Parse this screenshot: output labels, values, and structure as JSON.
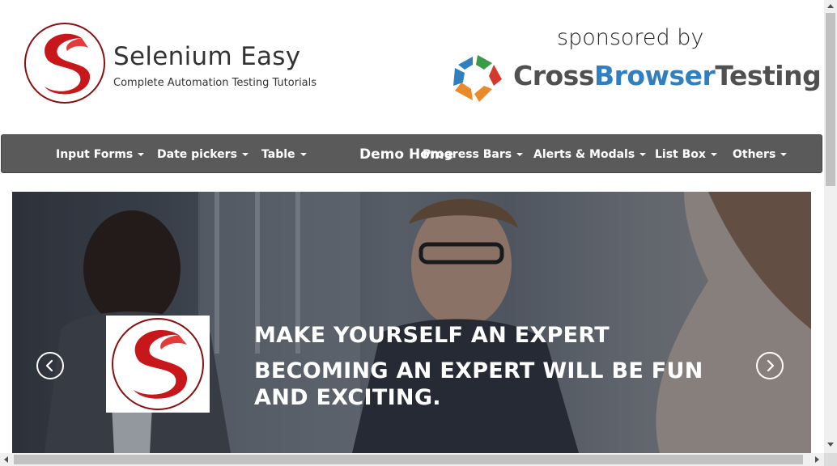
{
  "brand": {
    "title": "Selenium Easy",
    "subtitle": "Complete Automation Testing Tutorials",
    "logo_icon": "selenium-easy-s-logo"
  },
  "sponsor": {
    "label": "sponsored by",
    "name_part1": "Cross",
    "name_part2": "Browser",
    "name_part3": "Testing",
    "logo_icon": "crossbrowsertesting-logo",
    "colors": {
      "gray": "#505050",
      "blue": "#2f7fc1",
      "green": "#3a9a48",
      "orange": "#e98b2a",
      "red": "#d23a2e"
    }
  },
  "nav": {
    "home_label": "Demo Home",
    "items": [
      {
        "label": "Input Forms"
      },
      {
        "label": "Date pickers"
      },
      {
        "label": "Table"
      },
      {
        "label": "Progress Bars"
      },
      {
        "label": "Alerts & Modals"
      },
      {
        "label": "List Box"
      },
      {
        "label": "Others"
      }
    ],
    "background": "#5a5a5a"
  },
  "carousel": {
    "heading": "MAKE YOURSELF AN EXPERT",
    "text": "BECOMING AN EXPERT WILL BE FUN AND EXCITING.",
    "prev_icon": "chevron-left-icon",
    "next_icon": "chevron-right-icon"
  }
}
